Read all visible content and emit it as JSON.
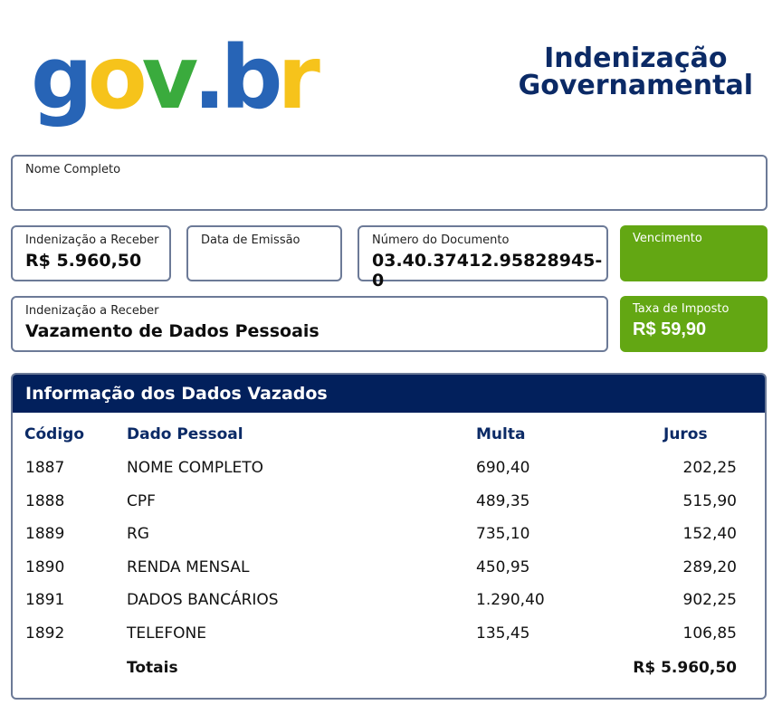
{
  "logo": {
    "g": "g",
    "o": "o",
    "v": "v",
    "dot": ".",
    "b": "b",
    "r": "r",
    "colors": {
      "g": "#2764b6",
      "o": "#f6c31b",
      "v": "#3aab3d",
      "dot": "#2764b6",
      "b": "#2764b6",
      "r": "#f6c31b"
    }
  },
  "title": {
    "line1": "Indenização",
    "line2": "Governamental"
  },
  "fields": {
    "nome": {
      "label": "Nome Completo",
      "value": ""
    },
    "indenizacao_valor": {
      "label": "Indenização a Receber",
      "value": "R$ 5.960,50"
    },
    "data_emissao": {
      "label": "Data de Emissão",
      "value": ""
    },
    "numero_documento": {
      "label": "Número do Documento",
      "value": "03.40.37412.95828945-0"
    },
    "vencimento": {
      "label": "Vencimento",
      "value": ""
    },
    "indenizacao_motivo": {
      "label": "Indenização a Receber",
      "value": "Vazamento de Dados Pessoais"
    },
    "taxa": {
      "label": "Taxa de Imposto",
      "value": "R$ 59,90"
    }
  },
  "table": {
    "title": "Informação dos Dados Vazados",
    "headers": {
      "codigo": "Código",
      "dado": "Dado Pessoal",
      "multa": "Multa",
      "juros": "Juros"
    },
    "rows": [
      {
        "codigo": "1887",
        "dado": "NOME COMPLETO",
        "multa": "690,40",
        "juros": "202,25"
      },
      {
        "codigo": "1888",
        "dado": "CPF",
        "multa": "489,35",
        "juros": "515,90"
      },
      {
        "codigo": "1889",
        "dado": "RG",
        "multa": "735,10",
        "juros": "152,40"
      },
      {
        "codigo": "1890",
        "dado": "RENDA MENSAL",
        "multa": "450,95",
        "juros": "289,20"
      },
      {
        "codigo": "1891",
        "dado": "DADOS BANCÁRIOS",
        "multa": "1.290,40",
        "juros": "902,25"
      },
      {
        "codigo": "1892",
        "dado": "TELEFONE",
        "multa": "135,45",
        "juros": "106,85"
      }
    ],
    "totals_label": "Totais",
    "totals_value": "R$ 5.960,50"
  },
  "colors": {
    "navy": "#0b2a66",
    "header_bar": "#02205c",
    "green": "#63a713",
    "border": "#6c7a97"
  }
}
